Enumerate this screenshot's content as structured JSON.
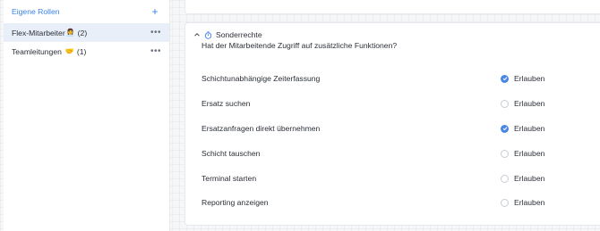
{
  "sidebar": {
    "title": "Eigene Rollen",
    "items": [
      {
        "label": "Flex-Mitarbeiter",
        "icon": "person-icon",
        "icon_glyph": "👩‍💼",
        "count": "(2)",
        "active": true
      },
      {
        "label": "Teamleitungen",
        "icon": "handshake-icon",
        "icon_glyph": "🤝",
        "count": "(1)",
        "active": false
      }
    ]
  },
  "section": {
    "title": "Sonderrechte",
    "subtitle": "Hat der Mitarbeitende Zugriff auf zusätzliche Funktionen?",
    "permissions": [
      {
        "label": "Schichtunabhängige Zeiterfassung",
        "allow_label": "Erlauben",
        "checked": true
      },
      {
        "label": "Ersatz suchen",
        "allow_label": "Erlauben",
        "checked": false
      },
      {
        "label": "Ersatzanfragen direkt übernehmen",
        "allow_label": "Erlauben",
        "checked": true
      },
      {
        "label": "Schicht tauschen",
        "allow_label": "Erlauben",
        "checked": false
      },
      {
        "label": "Terminal starten",
        "allow_label": "Erlauben",
        "checked": false
      },
      {
        "label": "Reporting anzeigen",
        "allow_label": "Erlauben",
        "checked": false
      }
    ]
  },
  "colors": {
    "accent": "#3b82e6",
    "checked": "#4a86e4",
    "active_row": "#e8eff9"
  }
}
